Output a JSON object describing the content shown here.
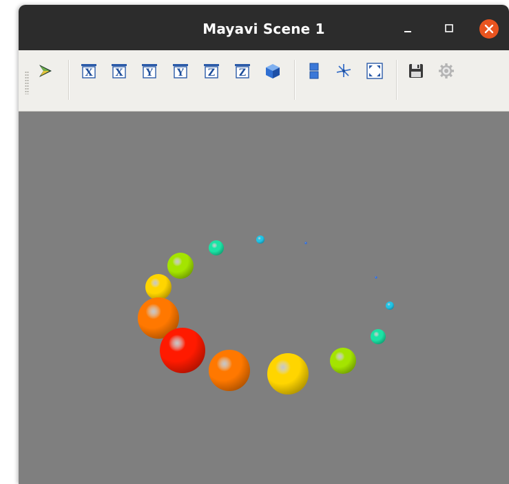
{
  "window": {
    "title": "Mayavi Scene 1"
  },
  "window_controls": [
    "minimize",
    "maximize",
    "close"
  ],
  "toolbar": {
    "buttons": [
      {
        "name": "mayavi-logo-icon",
        "glyph": "logo"
      },
      {
        "name": "view-x-positive-button",
        "glyph": "X"
      },
      {
        "name": "view-x-negative-button",
        "glyph": "X"
      },
      {
        "name": "view-y-positive-button",
        "glyph": "Y"
      },
      {
        "name": "view-y-negative-button",
        "glyph": "Y"
      },
      {
        "name": "view-z-positive-button",
        "glyph": "Z"
      },
      {
        "name": "view-z-negative-button",
        "glyph": "Z"
      },
      {
        "name": "isometric-view-button",
        "glyph": "cube"
      },
      {
        "name": "parallel-projection-button",
        "glyph": "projection"
      },
      {
        "name": "show-axes-button",
        "glyph": "axes"
      },
      {
        "name": "fullscreen-button",
        "glyph": "fullscreen"
      },
      {
        "name": "save-button",
        "glyph": "floppy"
      },
      {
        "name": "settings-button",
        "glyph": "gear"
      }
    ]
  },
  "scene": {
    "background_color": "#7f7f7f",
    "spheres": [
      {
        "color": "#ff1a00",
        "size": "largest"
      },
      {
        "color": "#ff7800",
        "size": "large"
      },
      {
        "color": "#ffd500",
        "size": "large"
      },
      {
        "color": "#a4e400",
        "size": "medium"
      },
      {
        "color": "#1be3a5",
        "size": "small"
      },
      {
        "color": "#21c4e6",
        "size": "tiny"
      },
      {
        "color": "#2a6ee8",
        "size": "dot"
      },
      {
        "color": "#2a6ee8",
        "size": "dot"
      },
      {
        "color": "#21c4e6",
        "size": "tiny"
      },
      {
        "color": "#1be3a5",
        "size": "small"
      },
      {
        "color": "#a4e400",
        "size": "medium"
      },
      {
        "color": "#ffd500",
        "size": "medium"
      },
      {
        "color": "#ff7800",
        "size": "large"
      }
    ]
  }
}
